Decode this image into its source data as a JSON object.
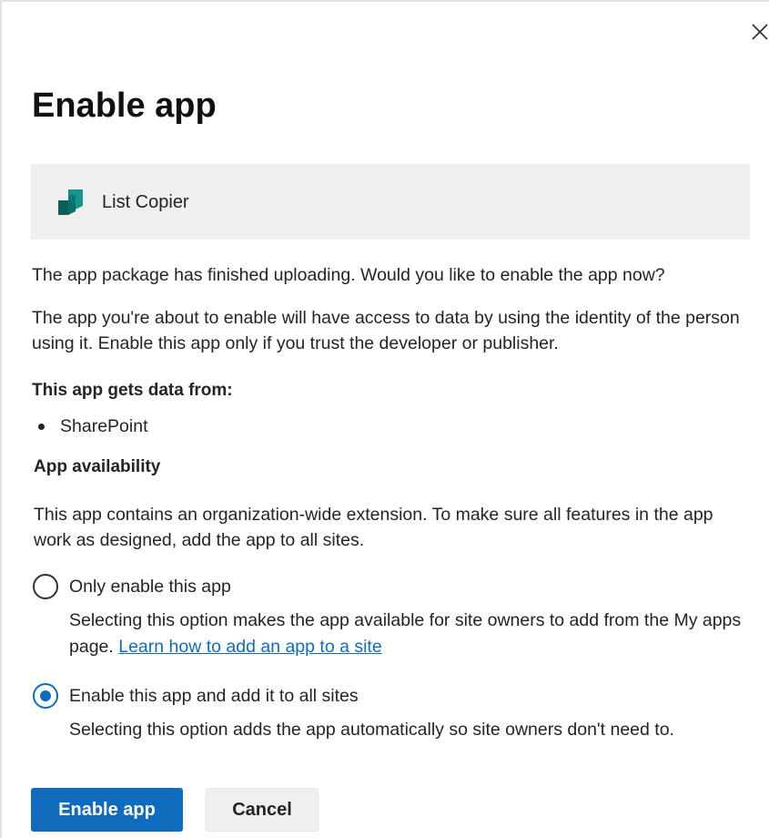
{
  "dialog": {
    "title": "Enable app",
    "close_icon": "close-icon"
  },
  "app": {
    "name": "List Copier",
    "icon": "app-package-icon",
    "icon_color": "#0f7b75"
  },
  "messages": {
    "uploaded": "The app package has finished uploading. Would you like to enable the app now?",
    "access_warning": "The app you're about to enable will have access to data by using the identity of the person using it. Enable this app only if you trust the developer or publisher."
  },
  "data_sources": {
    "heading": "This app gets data from:",
    "items": [
      "SharePoint"
    ]
  },
  "availability": {
    "heading": "App availability",
    "description": "This app contains an organization-wide extension. To make sure all features in the app work as designed, add the app to all sites.",
    "options": [
      {
        "label": "Only enable this app",
        "description": "Selecting this option makes the app available for site owners to add from the My apps page.",
        "link_text": "Learn how to add an app to a site",
        "selected": false
      },
      {
        "label": "Enable this app and add it to all sites",
        "description": "Selecting this option adds the app automatically so site owners don't need to.",
        "selected": true
      }
    ]
  },
  "buttons": {
    "primary": "Enable app",
    "secondary": "Cancel"
  },
  "colors": {
    "accent": "#0f6cbd",
    "card_background": "#efefef"
  }
}
